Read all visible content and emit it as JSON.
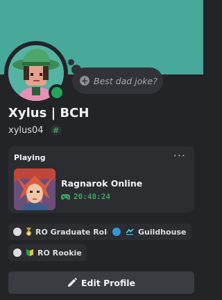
{
  "profile": {
    "display_name": "Xylus | BCH",
    "username": "xylus04",
    "tag_symbol": "#",
    "status": "online",
    "banner_color": "#48a89a",
    "status_color": "#23a55a"
  },
  "custom_status": {
    "placeholder": "Best dad joke?",
    "icon": "plus-circle-icon"
  },
  "activity": {
    "header": "Playing",
    "more_icon": "more-horizontal-icon",
    "game_name": "Ragnarok Online",
    "elapsed": "20:48:24",
    "elapsed_icon": "gamepad-icon"
  },
  "roles": [
    {
      "label": "RO Graduate Role",
      "dot_color": "#dbdee1",
      "icon": "medal-icon"
    },
    {
      "label": "Guildhouse",
      "dot_color": "#3498db",
      "icon": "guild-logo-icon"
    },
    {
      "label": "RO Rookie",
      "dot_color": "#dbdee1",
      "icon": "leaf-badge-icon"
    }
  ],
  "edit_button": {
    "label": "Edit Profile",
    "icon": "pencil-icon"
  },
  "colors": {
    "background": "#232428",
    "card": "#2b2d31",
    "accent_green": "#3ba55d",
    "button": "#3a3c42"
  }
}
